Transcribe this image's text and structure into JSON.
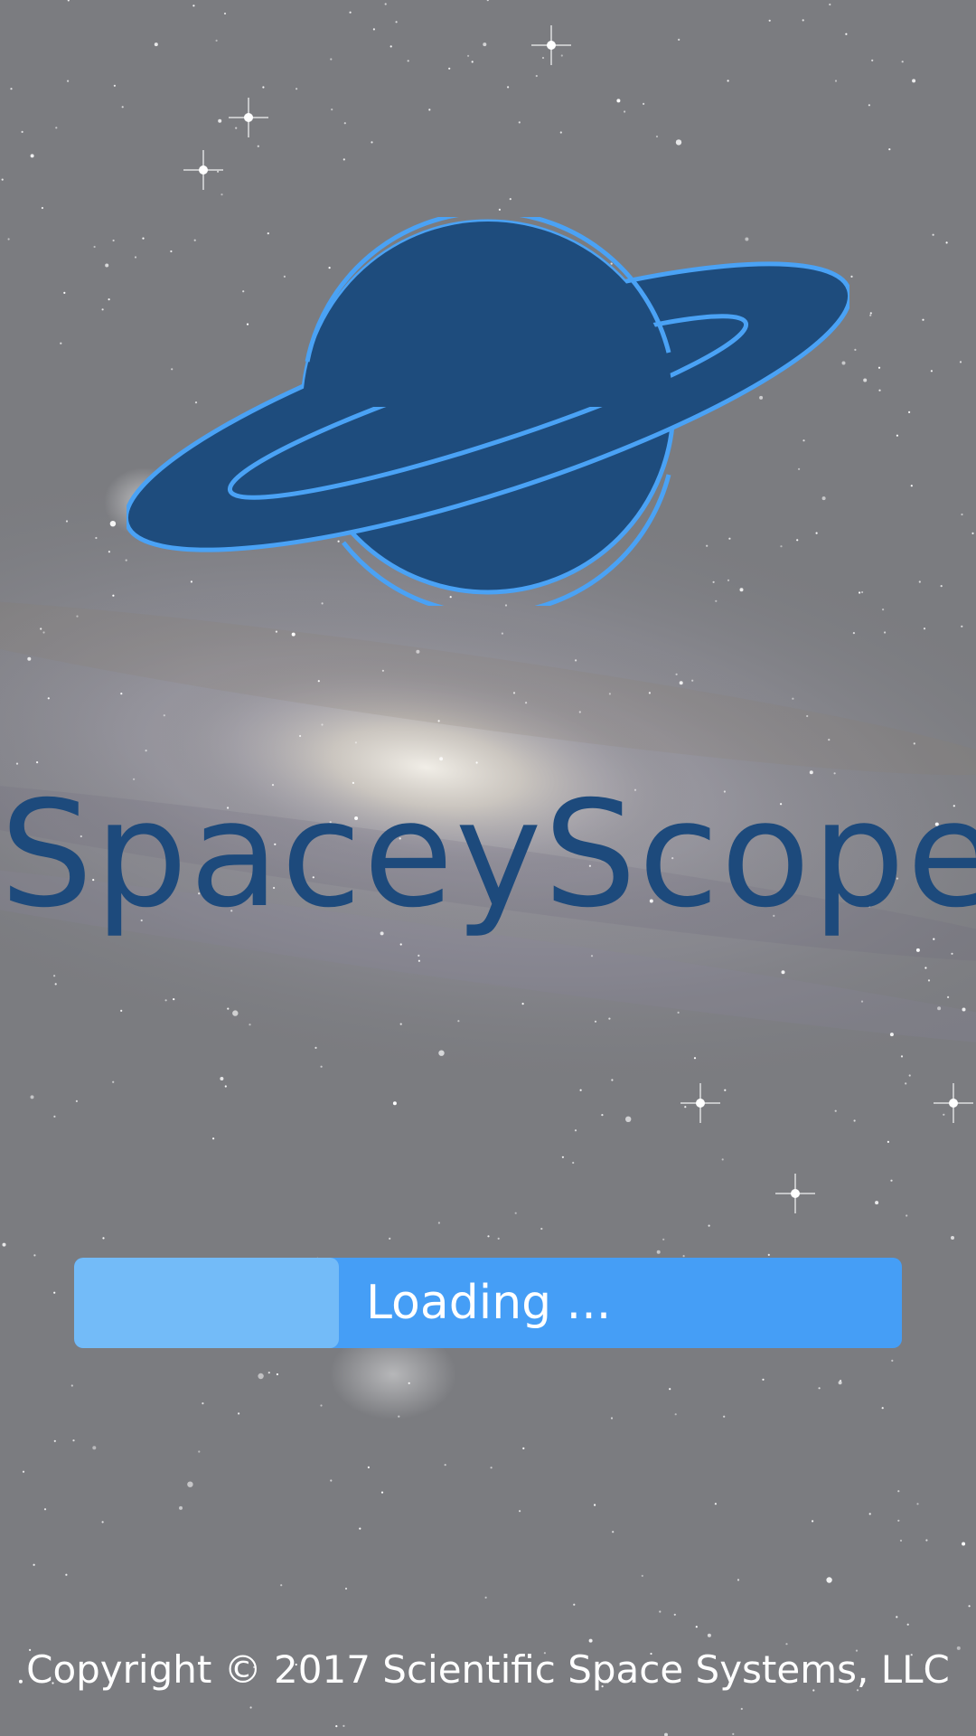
{
  "app": {
    "title": "SpaceyScope"
  },
  "loading": {
    "label": "Loading ...",
    "progress_fraction": 0.32
  },
  "footer": {
    "copyright": "Copyright © 2017 Scientific Space Systems, LLC"
  },
  "colors": {
    "logo_fill": "#1e4c7d",
    "logo_outline": "#4aa2f5",
    "title": "#1d4a7c",
    "progress_track": "#459ef6",
    "progress_fill": "#73bbf8",
    "text_light": "#ffffff"
  },
  "icons": {
    "logo": "ringed-planet-icon"
  }
}
